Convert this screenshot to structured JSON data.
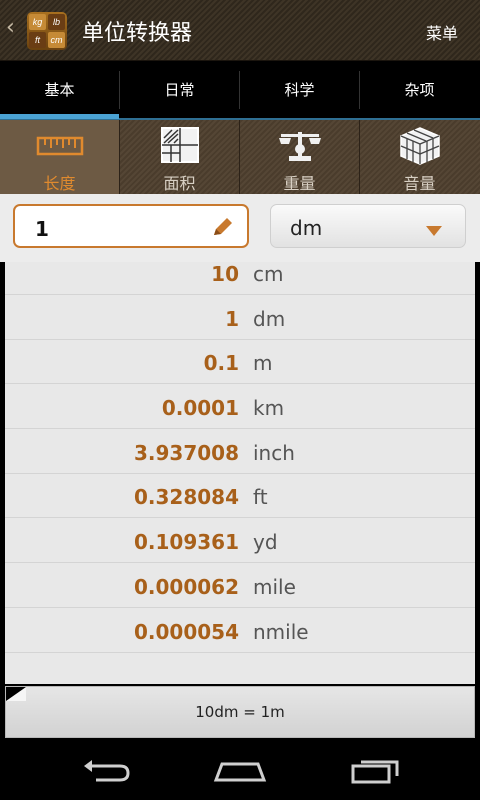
{
  "app": {
    "title": "单位转换器",
    "menu_label": "菜单",
    "icon_cells": [
      "kg",
      "lb",
      "ft",
      "cm"
    ]
  },
  "tabs": [
    {
      "label": "基本",
      "active": true
    },
    {
      "label": "日常",
      "active": false
    },
    {
      "label": "科学",
      "active": false
    },
    {
      "label": "杂项",
      "active": false
    }
  ],
  "categories": [
    {
      "label": "长度",
      "icon": "ruler-icon",
      "active": true
    },
    {
      "label": "面积",
      "icon": "area-grid-icon",
      "active": false
    },
    {
      "label": "重量",
      "icon": "scale-icon",
      "active": false
    },
    {
      "label": "音量",
      "icon": "cube-icon",
      "active": false
    }
  ],
  "input": {
    "value": "1",
    "unit": "dm"
  },
  "results": [
    {
      "value": "10",
      "unit": "cm"
    },
    {
      "value": "1",
      "unit": "dm"
    },
    {
      "value": "0.1",
      "unit": "m"
    },
    {
      "value": "0.0001",
      "unit": "km"
    },
    {
      "value": "3.937008",
      "unit": "inch"
    },
    {
      "value": "0.328084",
      "unit": "ft"
    },
    {
      "value": "0.109361",
      "unit": "yd"
    },
    {
      "value": "0.000062",
      "unit": "mile"
    },
    {
      "value": "0.000054",
      "unit": "nmile"
    }
  ],
  "summary": "10dm = 1m",
  "colors": {
    "accent_orange": "#c8792e",
    "value_brown": "#a8601a",
    "tab_indicator_blue": "#4ba3d4"
  }
}
